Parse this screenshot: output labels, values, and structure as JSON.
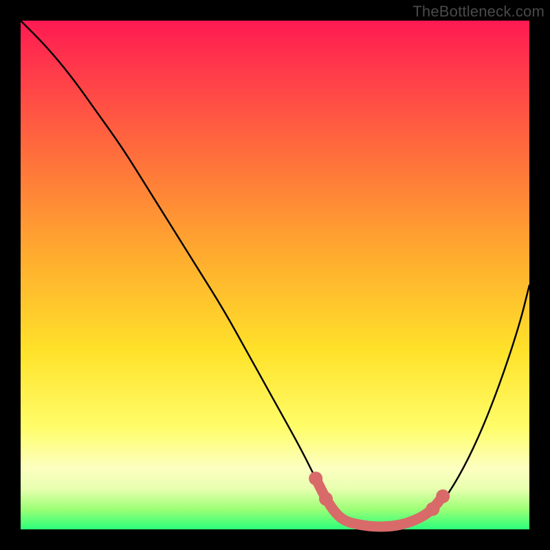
{
  "watermark": "TheBottleneck.com",
  "chart_data": {
    "type": "line",
    "title": "",
    "xlabel": "",
    "ylabel": "",
    "xlim": [
      0,
      100
    ],
    "ylim": [
      0,
      100
    ],
    "series": [
      {
        "name": "bottleneck-curve",
        "color": "#000000",
        "x": [
          0,
          5,
          10,
          15,
          20,
          25,
          30,
          35,
          40,
          45,
          50,
          55,
          58,
          60,
          63,
          66,
          70,
          74,
          78,
          82,
          86,
          90,
          94,
          98,
          100
        ],
        "y": [
          100,
          95,
          89,
          82,
          75,
          67,
          59,
          51,
          43,
          34,
          25,
          16,
          10,
          6,
          3,
          1,
          0.5,
          0.5,
          1,
          4,
          10,
          18,
          28,
          40,
          48
        ]
      },
      {
        "name": "optimal-band",
        "color": "#d86a6a",
        "points": [
          {
            "x": 58,
            "y": 10
          },
          {
            "x": 60,
            "y": 6
          },
          {
            "x": 62,
            "y": 3
          },
          {
            "x": 64,
            "y": 1.5
          },
          {
            "x": 67,
            "y": 0.8
          },
          {
            "x": 70,
            "y": 0.5
          },
          {
            "x": 73,
            "y": 0.6
          },
          {
            "x": 76,
            "y": 1.2
          },
          {
            "x": 79,
            "y": 2.5
          },
          {
            "x": 81,
            "y": 4
          },
          {
            "x": 83,
            "y": 6.5
          }
        ]
      }
    ]
  }
}
